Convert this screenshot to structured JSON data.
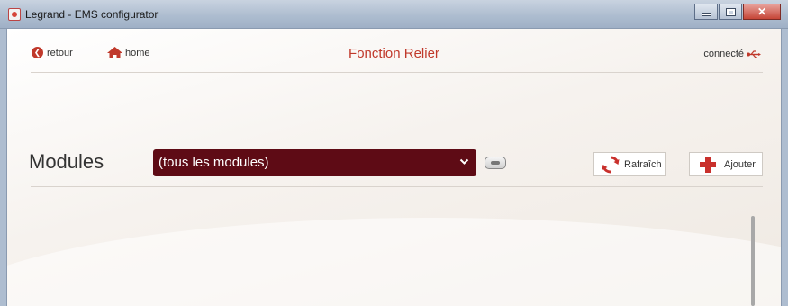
{
  "window": {
    "title": "Legrand - EMS configurator"
  },
  "header": {
    "back_label": "retour",
    "home_label": "home",
    "title": "Fonction Relier",
    "status_label": "connecté"
  },
  "modules": {
    "label": "Modules",
    "filter_selected": "(tous les modules)",
    "refresh_label": "Rafraîch",
    "add_label": "Ajouter"
  },
  "colors": {
    "accent": "#c0392b",
    "select_bg": "#5e0b15"
  }
}
